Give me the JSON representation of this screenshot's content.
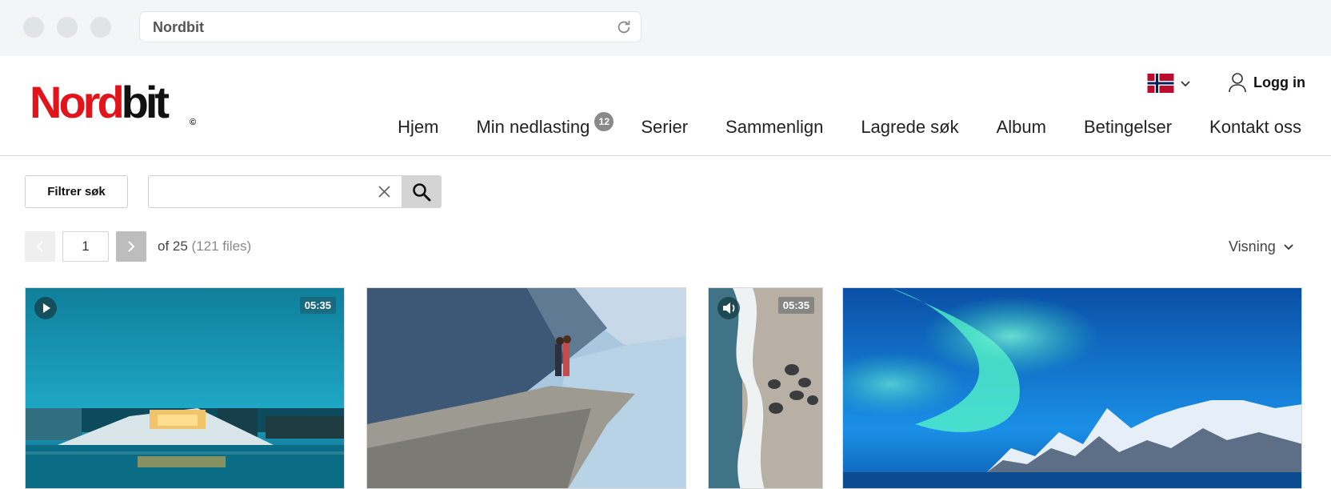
{
  "browser": {
    "address": "Nordbit"
  },
  "logo": {
    "red": "Nord",
    "black": "bit",
    "mark": "©",
    "red_color": "#e3131b"
  },
  "header": {
    "language_flag": "norway-flag-icon",
    "login_label": "Logg in"
  },
  "nav": [
    {
      "label": "Hjem"
    },
    {
      "label": "Min nedlasting",
      "badge": "12"
    },
    {
      "label": "Serier"
    },
    {
      "label": "Sammenlign"
    },
    {
      "label": "Lagrede søk"
    },
    {
      "label": "Album"
    },
    {
      "label": "Betingelser"
    },
    {
      "label": "Kontakt oss"
    }
  ],
  "toolbar": {
    "filter_label": "Filtrer søk",
    "search_value": "",
    "search_placeholder": ""
  },
  "pagination": {
    "page": "1",
    "of_text": "of 25",
    "files_text": "(121 files)"
  },
  "view": {
    "label": "Visning"
  },
  "gallery": [
    {
      "subject": "opera-house-night",
      "type": "video",
      "duration": "05:35"
    },
    {
      "subject": "couple-on-cliff",
      "type": "image"
    },
    {
      "subject": "aerial-beach",
      "type": "audio",
      "duration": "05:35"
    },
    {
      "subject": "northern-lights",
      "type": "image"
    }
  ]
}
